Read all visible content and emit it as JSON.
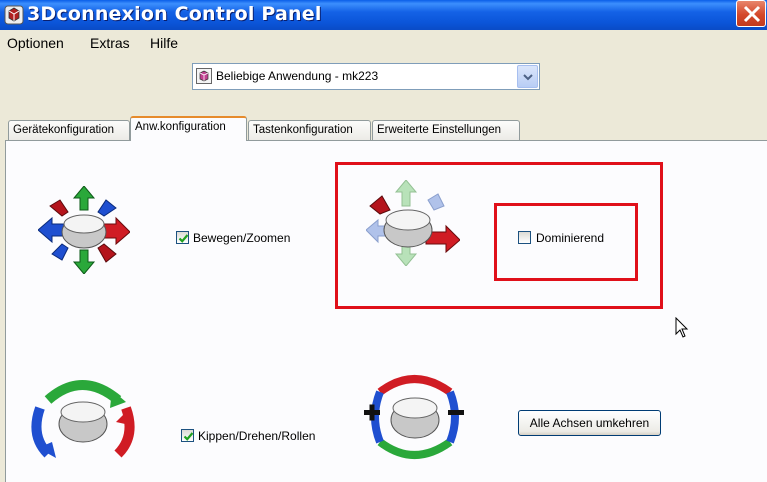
{
  "window": {
    "title": "3Dconnexion Control Panel"
  },
  "menu": {
    "items": [
      "Optionen",
      "Extras",
      "Hilfe"
    ]
  },
  "app_selector": {
    "value": "Beliebige Anwendung - mk223"
  },
  "tabs": [
    {
      "label": "Gerätekonfiguration",
      "active": false
    },
    {
      "label": "Anw.konfiguration",
      "active": true
    },
    {
      "label": "Tastenkonfiguration",
      "active": false
    },
    {
      "label": "Erweiterte Einstellungen",
      "active": false
    }
  ],
  "options": {
    "pan_zoom": {
      "label": "Bewegen/Zoomen",
      "checked": true
    },
    "dominant": {
      "label": "Dominierend",
      "checked": false
    },
    "rotation": {
      "label": "Kippen/Drehen/Rollen",
      "checked": true
    }
  },
  "reverse_button": {
    "label": "Alle Achsen umkehren"
  },
  "colors": {
    "highlight": "#e0101a",
    "titlebar": "#0b55d9",
    "active_tab_accent": "#e68b2c"
  }
}
